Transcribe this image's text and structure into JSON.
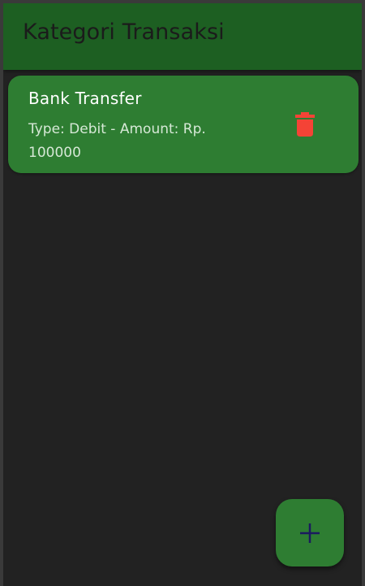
{
  "app_bar": {
    "title": "Kategori Transaksi"
  },
  "transactions": [
    {
      "title": "Bank Transfer",
      "subtitle": "Type: Debit - Amount: Rp. 100000",
      "action_icon": "trash-icon"
    }
  ],
  "fab": {
    "icon": "plus-icon"
  },
  "colors": {
    "app_bar": "#1d5f22",
    "card": "#2e7d32",
    "background": "#222222",
    "delete_icon": "#f44336",
    "fab_icon": "#1a1a5e"
  }
}
